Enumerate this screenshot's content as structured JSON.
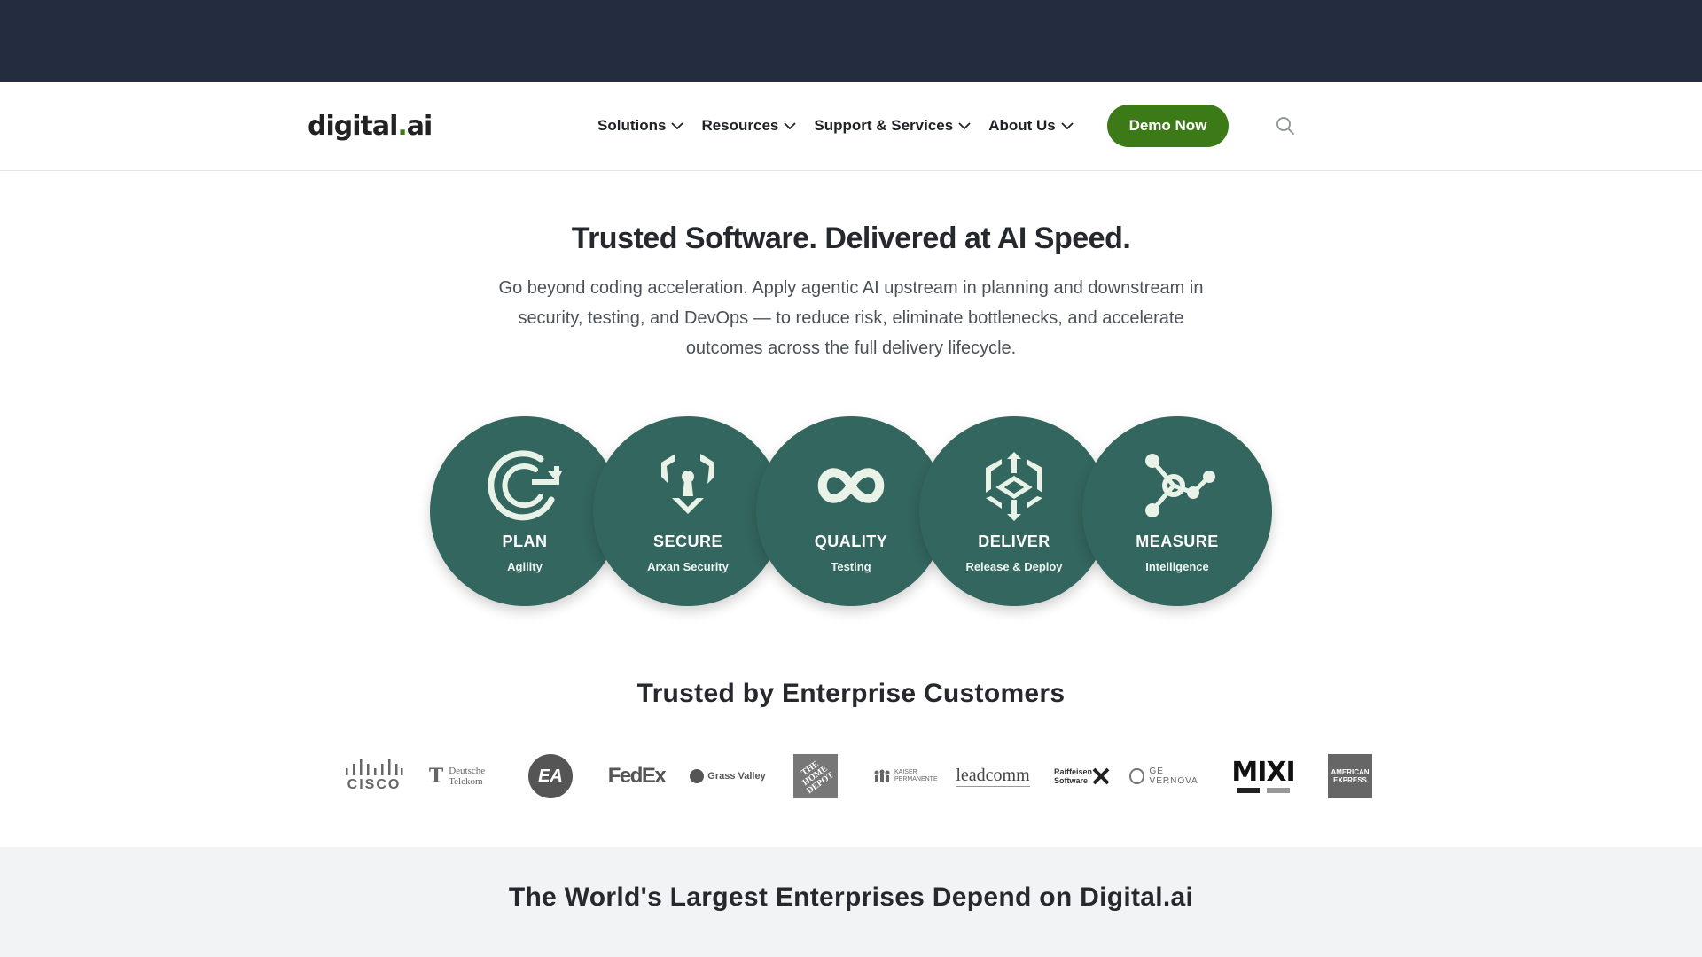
{
  "header": {
    "logo": {
      "main": "digital",
      "dot": ".",
      "ai": "ai"
    },
    "nav": [
      {
        "label": "Solutions"
      },
      {
        "label": "Resources"
      },
      {
        "label": "Support & Services"
      },
      {
        "label": "About Us"
      }
    ],
    "cta_label": "Demo Now",
    "search_icon": "search-icon",
    "accent": "#3b7a16"
  },
  "hero": {
    "title": "Trusted Software. Delivered at AI Speed.",
    "subtitle": "Go beyond coding acceleration. Apply agentic AI upstream in planning and downstream in security, testing, and DevOps — to reduce risk, eliminate bottlenecks, and accelerate outcomes across the full delivery lifecycle."
  },
  "pillars": [
    {
      "title": "PLAN",
      "subtitle": "Agility",
      "icon": "plan-icon"
    },
    {
      "title": "SECURE",
      "subtitle": "Arxan Security",
      "icon": "secure-icon"
    },
    {
      "title": "QUALITY",
      "subtitle": "Testing",
      "icon": "quality-icon"
    },
    {
      "title": "DELIVER",
      "subtitle": "Release & Deploy",
      "icon": "deliver-icon"
    },
    {
      "title": "MEASURE",
      "subtitle": "Intelligence",
      "icon": "measure-icon"
    }
  ],
  "pillar_color": "#33665e",
  "customers": {
    "title": "Trusted by Enterprise Customers",
    "logos": [
      {
        "name": "cisco-logo",
        "text": "CISCO"
      },
      {
        "name": "deutsche-telekom-logo",
        "text": "Deutsche Telekom"
      },
      {
        "name": "ea-logo",
        "text": "EA"
      },
      {
        "name": "fedex-logo",
        "text": "FedEx"
      },
      {
        "name": "grass-valley-logo",
        "text": "Grass Valley"
      },
      {
        "name": "home-depot-logo",
        "text": "THE HOME DEPOT"
      },
      {
        "name": "kaiser-permanente-logo",
        "text": "KAISER PERMANENTE"
      },
      {
        "name": "leadcomm-logo",
        "text": "leadcomm"
      },
      {
        "name": "raiffeisen-logo",
        "text": "Raiffeisen Software"
      },
      {
        "name": "ge-vernova-logo",
        "text": "GE VERNOVA"
      },
      {
        "name": "mixi-logo",
        "text": "MIXI"
      },
      {
        "name": "american-express-logo",
        "text": "AMERICAN EXPRESS"
      }
    ]
  },
  "bottom": {
    "title": "The World's Largest Enterprises Depend on Digital.ai"
  }
}
